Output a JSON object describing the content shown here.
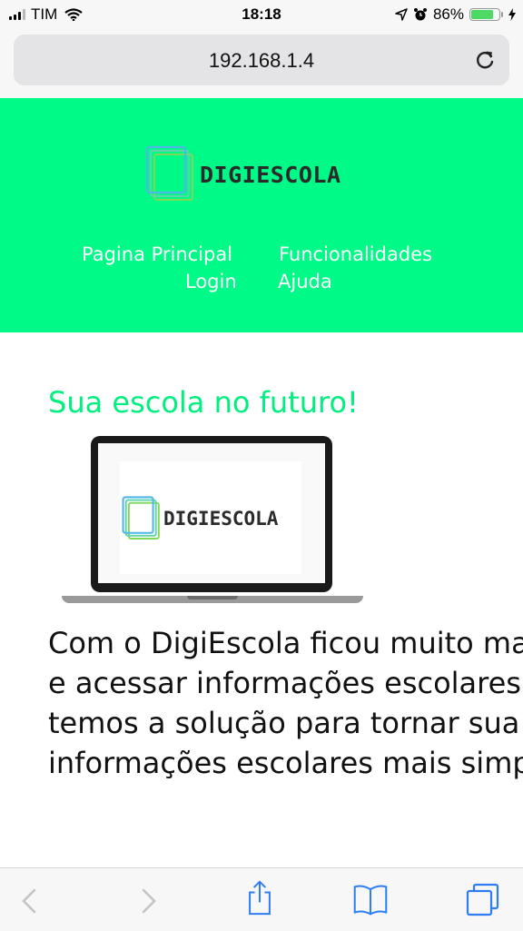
{
  "status_bar": {
    "carrier": "TIM",
    "time": "18:18",
    "battery_percent": "86%",
    "battery_level": 0.86,
    "icons": [
      "signal-icon",
      "wifi-icon",
      "location-arrow-icon",
      "alarm-icon",
      "battery-icon",
      "charging-bolt-icon"
    ]
  },
  "browser": {
    "url": "192.168.1.4",
    "reload_icon": "reload-icon",
    "toolbar_icons": [
      "back-icon",
      "forward-icon",
      "share-icon",
      "bookmarks-icon",
      "tabs-icon"
    ]
  },
  "site": {
    "logo_text": "DIGIESCOLA",
    "nav": {
      "home": "Pagina Principal",
      "features": "Funcionalidades",
      "login": "Login",
      "help": "Ajuda"
    },
    "headline": "Sua escola no futuro!",
    "laptop_logo_text": "DIGIESCOLA",
    "paragraph_lines": [
      "Com o DigiEscola ficou muito ma",
      "e acessar informações escolares",
      "temos a solução para tornar sua",
      "informações escolares mais simp"
    ]
  },
  "colors": {
    "header_bg": "#00fa87",
    "headline": "#00ef7e",
    "ios_blue": "#2f7df6"
  }
}
